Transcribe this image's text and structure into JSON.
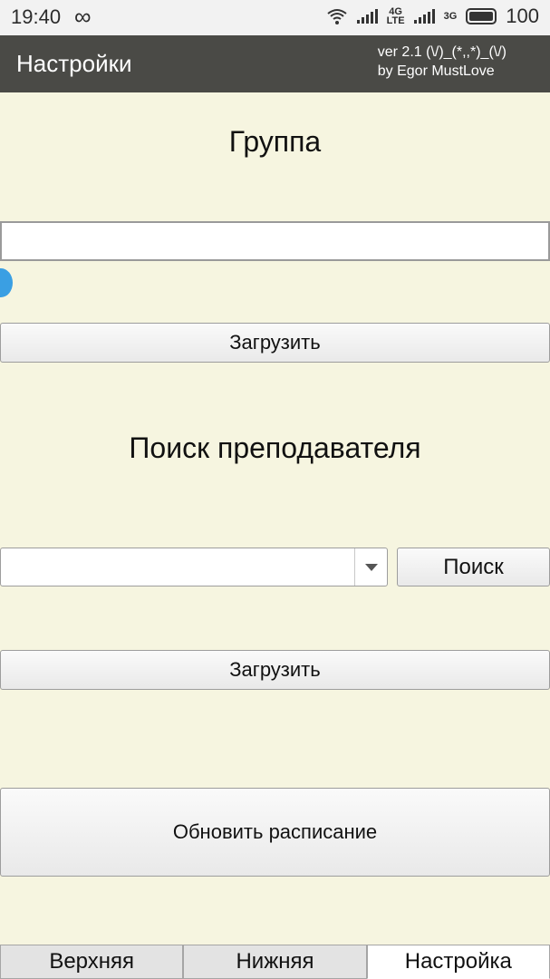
{
  "status_bar": {
    "time": "19:40",
    "loop_glyph": "∞",
    "net_4g": "4G",
    "net_lte": "LTE",
    "net_3g": "3G",
    "battery": "100"
  },
  "app_bar": {
    "title": "Настройки",
    "version_line1": "ver 2.1 (\\/)_(*,,*)_(\\/)",
    "version_line2": "by Egor MustLove"
  },
  "group_section": {
    "heading": "Группа",
    "input_value": "",
    "load_button": "Загрузить"
  },
  "teacher_section": {
    "heading": "Поиск преподавателя",
    "select_value": "",
    "search_button": "Поиск",
    "load_button": "Загрузить"
  },
  "refresh_button": "Обновить расписание",
  "tabs": [
    {
      "label": "Верхняя",
      "active": false
    },
    {
      "label": "Нижняя",
      "active": false
    },
    {
      "label": "Настройка",
      "active": true
    }
  ],
  "colors": {
    "background": "#f6f5e0",
    "app_bar": "#4a4a46",
    "cursor_handle": "#3a9fe3"
  }
}
